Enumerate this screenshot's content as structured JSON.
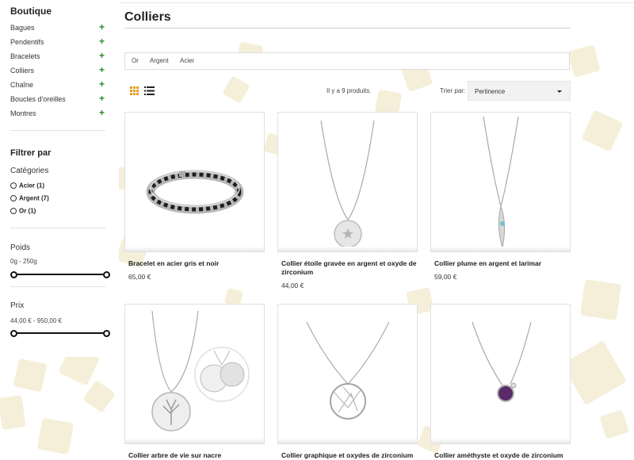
{
  "sidebar": {
    "title": "Boutique",
    "categories": [
      {
        "label": "Bagues"
      },
      {
        "label": "Pendentifs"
      },
      {
        "label": "Bracelets"
      },
      {
        "label": "Colliers"
      },
      {
        "label": "Chaîne"
      },
      {
        "label": "Boucles d'oreilles"
      },
      {
        "label": "Montres"
      }
    ],
    "expand_symbol": "+",
    "filter_title": "Filtrer par",
    "categories_facet": {
      "title": "Catégories",
      "options": [
        "Acier (1)",
        "Argent (7)",
        "Or (1)"
      ]
    },
    "weight": {
      "title": "Poids",
      "range_text": "0g - 250g",
      "min": 0,
      "max": 250,
      "selected": [
        0,
        250
      ]
    },
    "price": {
      "title": "Prix",
      "range_text": "44,00 € - 950,00 €",
      "min": 44,
      "max": 950,
      "selected": [
        44,
        950
      ]
    }
  },
  "main": {
    "title": "Colliers",
    "subcategories": [
      "Or",
      "Argent",
      "Acier"
    ],
    "count_text": "Il y a 9 produits.",
    "sort_label": "Trier par:",
    "sort_value": "Pertinence",
    "products": [
      {
        "name": "Bracelet en acier gris et noir",
        "price": "65,00 €",
        "image_icon": "bracelet-icon"
      },
      {
        "name": "Collier étoile gravée en argent et oxyde de zirconium",
        "price": "44,00 €",
        "image_icon": "star-pendant-necklace-icon"
      },
      {
        "name": "Collier plume en argent et larimar",
        "price": "59,00 €",
        "image_icon": "feather-pendant-necklace-icon"
      },
      {
        "name": "Collier arbre de vie sur nacre",
        "price": "",
        "image_icon": "tree-of-life-necklace-icon"
      },
      {
        "name": "Collier graphique et oxydes de zirconium",
        "price": "",
        "image_icon": "graphic-pendant-necklace-icon"
      },
      {
        "name": "Collier améthyste et oxyde de zirconium",
        "price": "",
        "image_icon": "amethyst-necklace-icon"
      }
    ]
  },
  "colors": {
    "accent_plus": "#2a8a2a",
    "background_squares": "#f3ecd3",
    "grid_icon": "#e0a020",
    "amethyst": "#5a2a6a"
  }
}
